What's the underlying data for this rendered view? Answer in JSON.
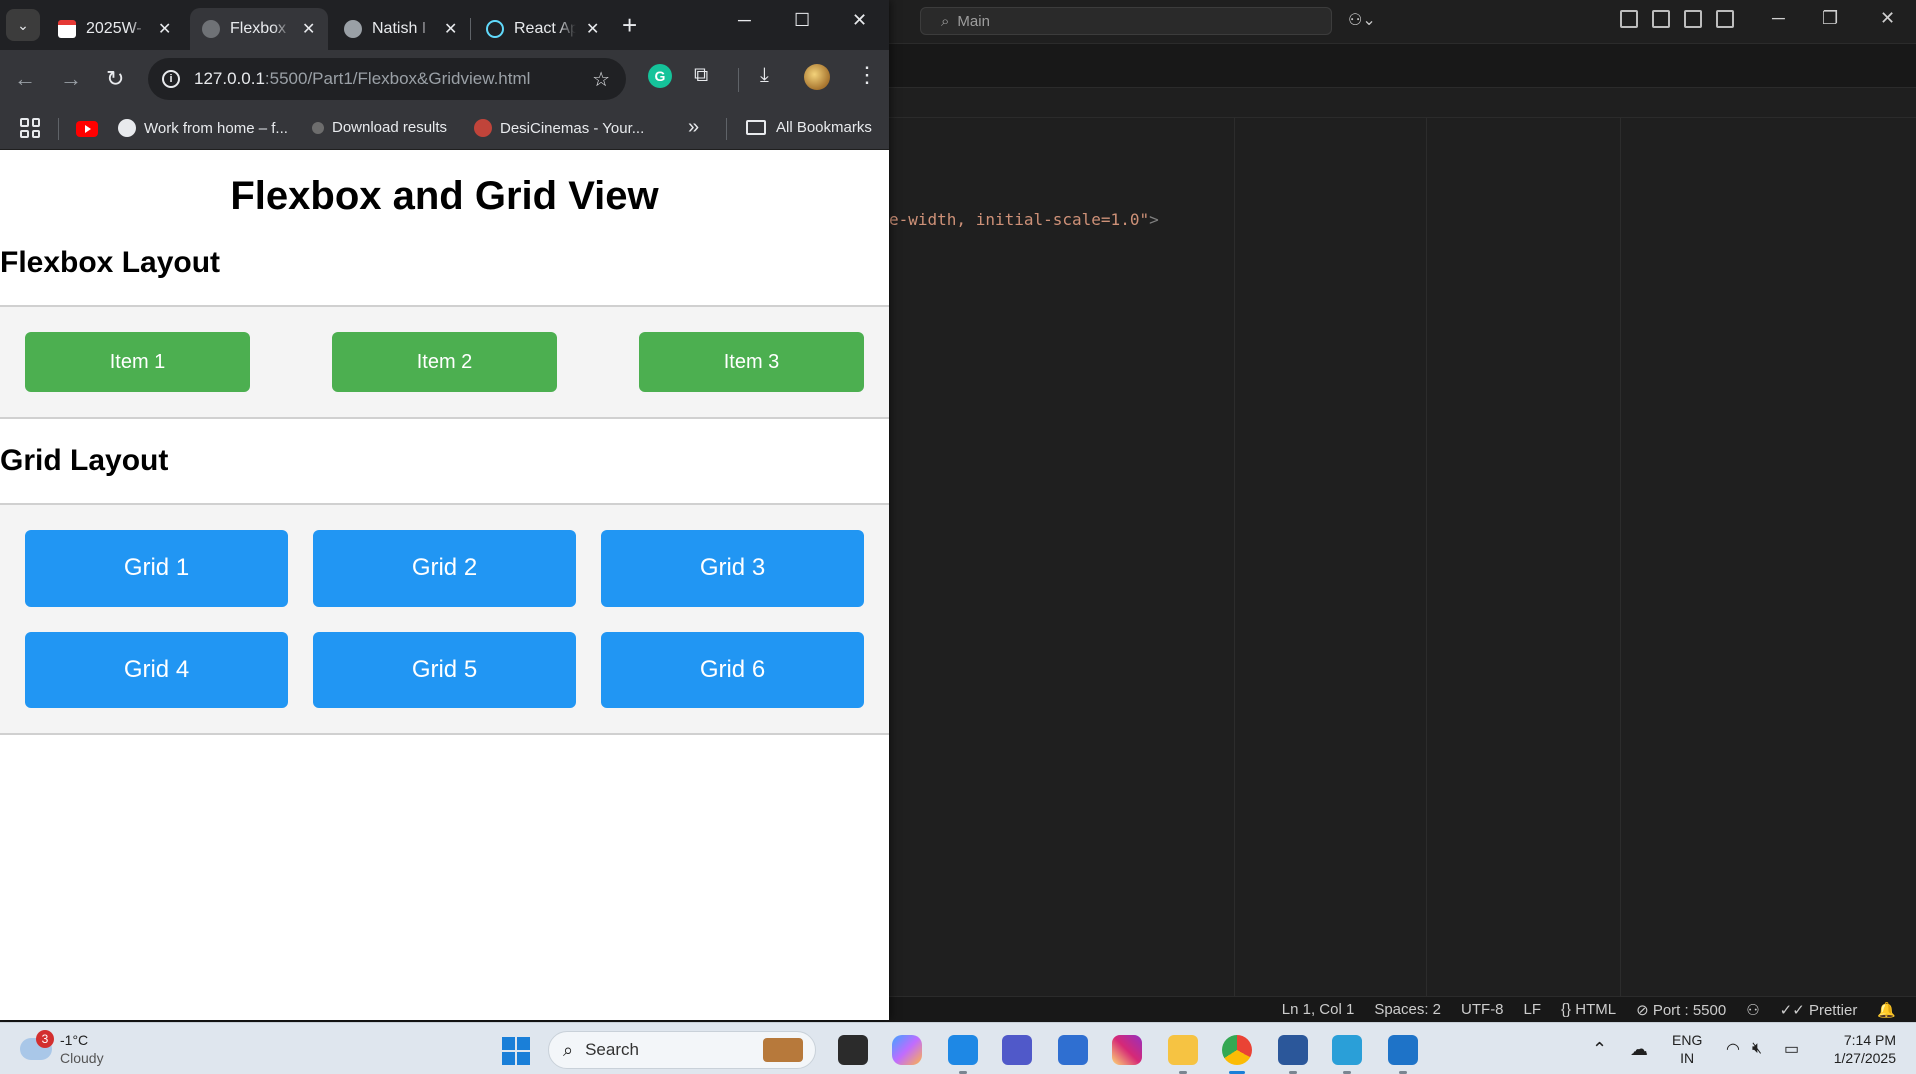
{
  "vscode": {
    "search_text": "Main",
    "code_line": "e-width, initial-scale=1.0\"",
    "code_close": ">",
    "status": {
      "position": "Ln 1, Col 1",
      "spaces": "Spaces: 2",
      "encoding": "UTF-8",
      "eol": "LF",
      "language": "{} HTML",
      "port": "⊘ Port : 5500",
      "prettier": "✓✓ Prettier",
      "bell": "🔔"
    }
  },
  "chrome": {
    "tabs": [
      {
        "title": "2025W-",
        "favicon_color": "#e53935"
      },
      {
        "title": "Flexbox",
        "favicon_color": "#8a8d91"
      },
      {
        "title": "Natish I",
        "favicon_color": "#9aa0a6"
      },
      {
        "title": "React Ap",
        "favicon_color": "#61dafb"
      }
    ],
    "url_host": "127.0.0.1",
    "url_path": ":5500/Part1/Flexbox&Gridview.html",
    "bookmarks": [
      {
        "label": "Work from home – f...",
        "icon_color": "#e8eaed"
      },
      {
        "label": "Download results",
        "icon_color": "#6d6d6d"
      },
      {
        "label": "DesiCinemas - Your...",
        "icon_color": "#c0443a"
      }
    ],
    "overflow_glyph": "»",
    "all_bookmarks": "All Bookmarks"
  },
  "page": {
    "title": "Flexbox and Grid View",
    "flex_heading": "Flexbox Layout",
    "flex_items": [
      "Item 1",
      "Item 2",
      "Item 3"
    ],
    "grid_heading": "Grid Layout",
    "grid_items": [
      "Grid 1",
      "Grid 2",
      "Grid 3",
      "Grid 4",
      "Grid 5",
      "Grid 6"
    ],
    "colors": {
      "flex_item": "#4caf50",
      "grid_item": "#2196f3"
    }
  },
  "taskbar": {
    "weather_badge": "3",
    "temperature": "-1°C",
    "condition": "Cloudy",
    "search_label": "Search",
    "lang_top": "ENG",
    "lang_bottom": "IN",
    "time": "7:14 PM",
    "date": "1/27/2025"
  }
}
